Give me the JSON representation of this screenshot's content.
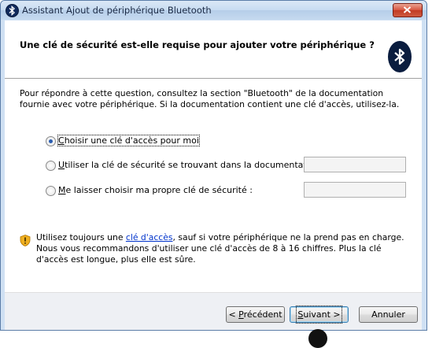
{
  "window": {
    "title": "Assistant Ajout de périphérique Bluetooth",
    "close_icon": "close-icon"
  },
  "header": {
    "question": "Une clé de sécurité est-elle requise pour ajouter votre périphérique ?",
    "badge_icon": "bluetooth-icon"
  },
  "content": {
    "intro": "Pour répondre à cette question, consultez la section \"Bluetooth\" de la documentation fournie avec votre périphérique. Si la documentation contient une clé d'accès, utilisez-la.",
    "options": [
      {
        "key": "C",
        "rest": "hoisir une clé d'accès pour moi",
        "selected": true
      },
      {
        "key": "U",
        "rest": "tiliser la clé de sécurité se trouvant dans la documentation :",
        "selected": false,
        "value": ""
      },
      {
        "key": "M",
        "rest": "e laisser choisir ma propre clé de sécurité :",
        "selected": false,
        "value": ""
      }
    ],
    "tip": {
      "before": "Utilisez toujours une ",
      "link": "clé d'accès",
      "after": ", sauf si votre périphérique ne la prend pas en charge. Nous vous recommandons d'utiliser une clé d'accès de 8 à 16 chiffres. Plus la clé d'accès est longue, plus elle est sûre.",
      "icon": "security-shield-icon"
    }
  },
  "footer": {
    "back_key": "P",
    "back_prefix": "< ",
    "back_rest": "récédent",
    "next_key": "S",
    "next_rest": "uivant >",
    "cancel": "Annuler"
  }
}
